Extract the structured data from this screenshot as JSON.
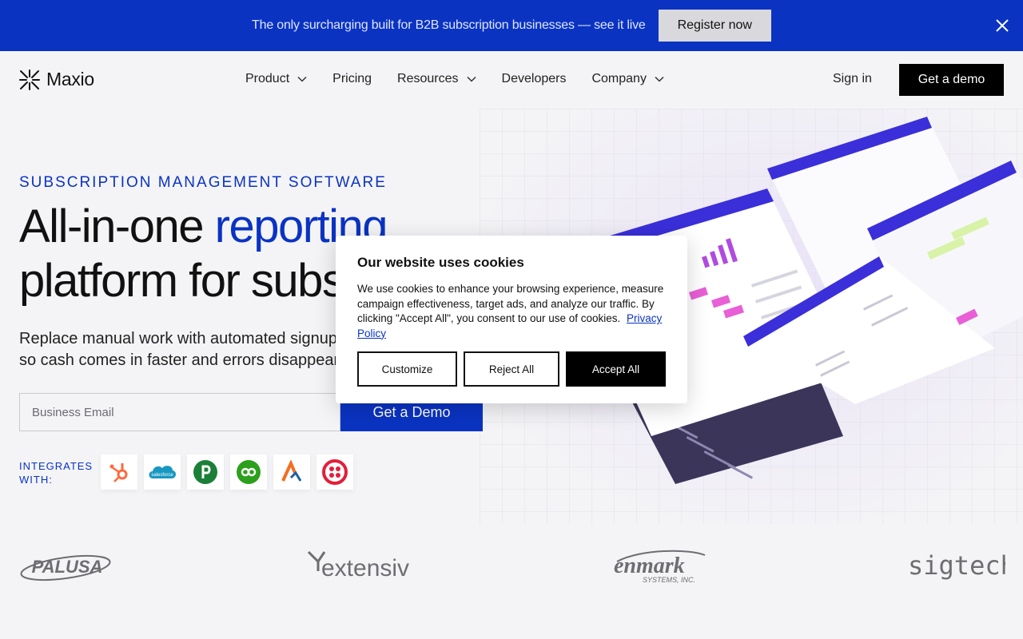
{
  "announcement": {
    "text": "The only surcharging built for B2B subscription businesses — see it live",
    "button": "Register now",
    "close_icon": "close-icon"
  },
  "nav": {
    "logo_text": "Maxio",
    "items": [
      {
        "label": "Product",
        "has_dropdown": true
      },
      {
        "label": "Pricing",
        "has_dropdown": false
      },
      {
        "label": "Resources",
        "has_dropdown": true
      },
      {
        "label": "Developers",
        "has_dropdown": false
      },
      {
        "label": "Company",
        "has_dropdown": true
      }
    ],
    "signin": "Sign in",
    "demo": "Get a demo"
  },
  "hero": {
    "eyebrow": "SUBSCRIPTION MANAGEMENT SOFTWARE",
    "headline_part1": "All-in-one ",
    "headline_accent": "reporting",
    "headline_line2": "platform for subs",
    "sub_line1": "Replace manual work with automated signups",
    "sub_line2": "so cash comes in faster and errors disappear.",
    "email_placeholder": "Business Email",
    "cta": "Get a Demo",
    "integrates_label": "INTEGRATES WITH:",
    "integrations": [
      "hubspot-logo",
      "salesforce-logo",
      "pipedrive-logo",
      "quickbooks-logo",
      "avalara-logo",
      "twilio-logo"
    ],
    "salesforce_text": "salesforce"
  },
  "customers": [
    "PALUSA",
    "extensiv",
    "enmark",
    "SYSTEMS, INC.",
    "sigtech"
  ],
  "cookie": {
    "title": "Our website uses cookies",
    "body": "We use cookies to enhance your browsing experience, measure campaign effectiveness, target ads, and analyze our traffic. By clicking \"Accept All\", you consent to our use of cookies.",
    "link": "Privacy Policy",
    "customize": "Customize",
    "reject": "Reject All",
    "accept": "Accept All"
  },
  "colors": {
    "brand_blue": "#0a33c2",
    "accent_purple": "#5a2be0",
    "pink": "#e85fd6"
  }
}
